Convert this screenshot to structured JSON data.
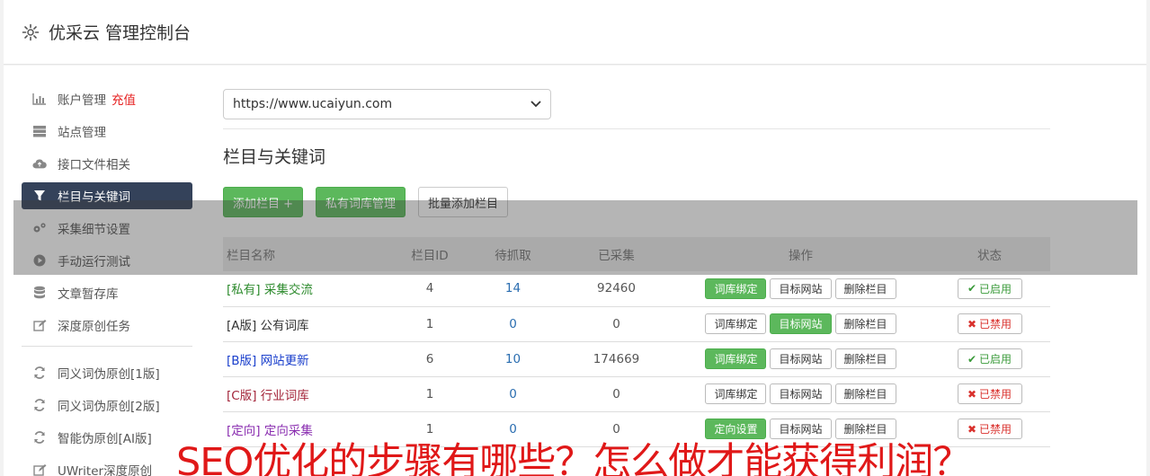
{
  "header": {
    "title": "优采云 管理控制台",
    "icon": "gear-icon"
  },
  "sidebar": {
    "items": [
      {
        "label": "账户管理",
        "extra": "充值",
        "icon": "bar-chart-icon"
      },
      {
        "label": "站点管理",
        "icon": "server-icon"
      },
      {
        "label": "接口文件相关",
        "icon": "cloud-upload-icon"
      },
      {
        "label": "栏目与关键词",
        "icon": "filter-icon",
        "active": true
      },
      {
        "label": "采集细节设置",
        "icon": "cogs-icon"
      },
      {
        "label": "手动运行测试",
        "icon": "play-circle-icon"
      },
      {
        "label": "文章暂存库",
        "icon": "database-icon"
      },
      {
        "label": "深度原创任务",
        "icon": "edit-icon"
      }
    ],
    "tools": [
      {
        "label": "同义词伪原创[1版]",
        "icon": "refresh-icon"
      },
      {
        "label": "同义词伪原创[2版]",
        "icon": "refresh-icon"
      },
      {
        "label": "智能伪原创[AI版]",
        "icon": "refresh-icon"
      },
      {
        "label": "UWriter深度原创",
        "icon": "edit-icon"
      }
    ]
  },
  "site_select": {
    "value": "https://www.ucaiyun.com"
  },
  "section": {
    "title": "栏目与关键词"
  },
  "buttons": {
    "add": "添加栏目 +",
    "private": "私有词库管理",
    "batch": "批量添加栏目"
  },
  "table": {
    "headers": [
      "栏目名称",
      "栏目ID",
      "待抓取",
      "已采集",
      "操作",
      "状态"
    ],
    "rows": [
      {
        "name": "[私有] 采集交流",
        "name_color": "#2e8b2e",
        "id": "4",
        "pending": "14",
        "collected": "92460",
        "op1": "词库绑定",
        "op2": "目标网站",
        "op3": "删除栏目",
        "status": "已启用"
      },
      {
        "name": "[A版] 公有词库",
        "name_color": "#333333",
        "id": "1",
        "pending": "0",
        "collected": "0",
        "op1": "词库绑定",
        "op2": "目标网站",
        "op3": "删除栏目",
        "status": "已禁用"
      },
      {
        "name": "[B版] 网站更新",
        "name_color": "#1a3fcc",
        "id": "6",
        "pending": "10",
        "collected": "174669",
        "op1": "词库绑定",
        "op2": "目标网站",
        "op3": "删除栏目",
        "status": "已启用"
      },
      {
        "name": "[C版] 行业词库",
        "name_color": "#a3253a",
        "id": "1",
        "pending": "0",
        "collected": "0",
        "op1": "词库绑定",
        "op2": "目标网站",
        "op3": "删除栏目",
        "status": "已禁用"
      },
      {
        "name": "[定向] 定向采集",
        "name_color": "#8a2eb0",
        "id": "1",
        "pending": "0",
        "collected": "0",
        "op1": "定向设置",
        "op2": "目标网站",
        "op3": "删除栏目",
        "status": "已禁用"
      }
    ]
  },
  "caption": "SEO优化的步骤有哪些？怎么做才能获得利润？",
  "colors": {
    "accent_green": "#5cb85c",
    "sidebar_active": "#34425a",
    "caption_red": "#e01818"
  }
}
